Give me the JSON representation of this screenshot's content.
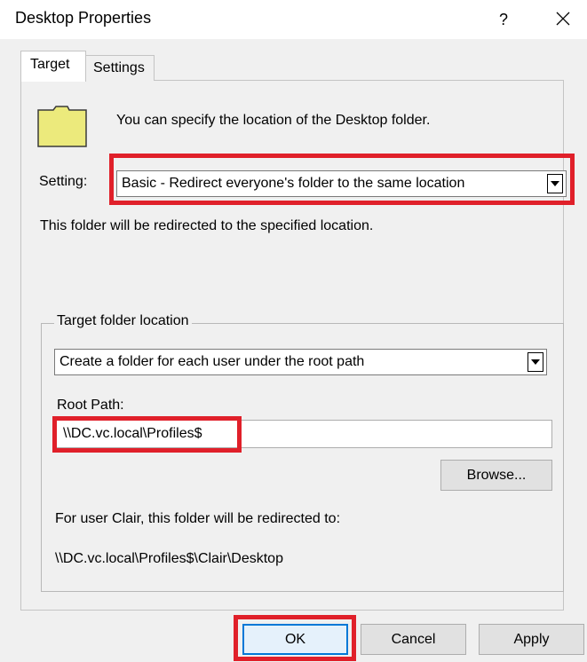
{
  "window": {
    "title": "Desktop Properties",
    "help_label": "?",
    "close_icon": "close-icon"
  },
  "tabs": [
    {
      "label": "Target",
      "active": true
    },
    {
      "label": "Settings",
      "active": false
    }
  ],
  "target_tab": {
    "intro": "You can specify the location of the Desktop folder.",
    "folder_icon": "folder-icon",
    "setting_label": "Setting:",
    "setting_value": "Basic - Redirect everyone's folder to the same location",
    "redirect_note": "This folder will be redirected to the specified location.",
    "group": {
      "legend": "Target folder location",
      "target_value": "Create a folder for each user under the root path",
      "root_path_label": "Root Path:",
      "root_path_value": "\\\\DC.vc.local\\Profiles$",
      "browse_label": "Browse...",
      "for_user_text": "For user Clair, this folder will be redirected to:",
      "for_user_path": "\\\\DC.vc.local\\Profiles$\\Clair\\Desktop"
    }
  },
  "footer": {
    "ok_label": "OK",
    "cancel_label": "Cancel",
    "apply_label": "Apply"
  },
  "colors": {
    "highlight": "#e0202a",
    "folder_fill": "#ecea7c",
    "focus_border": "#0078d7"
  }
}
